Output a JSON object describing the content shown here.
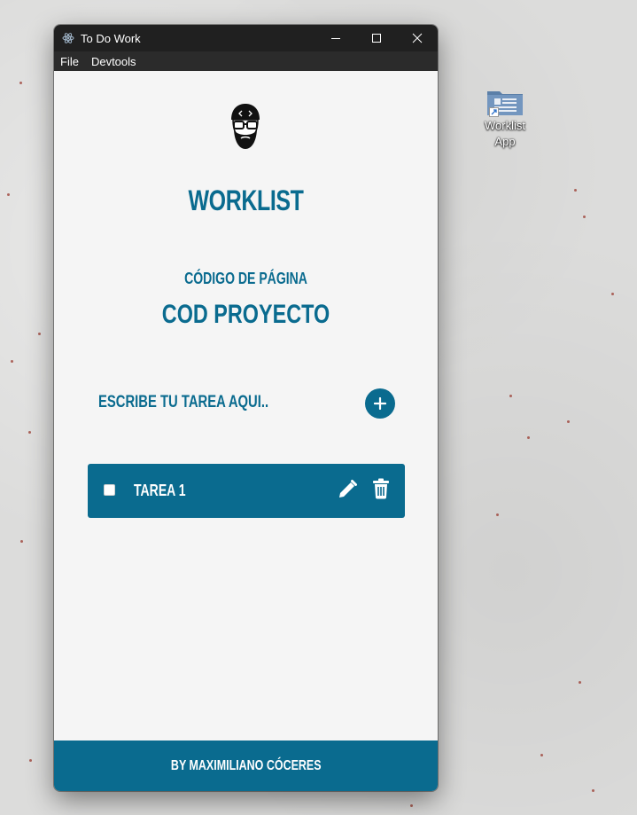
{
  "window": {
    "title": "To Do Work",
    "menu": [
      "File",
      "Devtools"
    ]
  },
  "app": {
    "title": "WORKLIST",
    "page_code_label": "CÓDIGO DE PÁGINA",
    "project_code": "COD PROYECTO",
    "task_input": {
      "placeholder": "ESCRIBE TU TAREA AQUI..",
      "value": ""
    },
    "add_button_label": "+",
    "tasks": [
      {
        "text": "TAREA 1",
        "done": false
      }
    ],
    "footer": "BY MAXIMILIANO CÓCERES"
  },
  "desktop": {
    "shortcut_label_line1": "Worklist",
    "shortcut_label_line2": "App"
  },
  "colors": {
    "accent": "#0a6b8f",
    "titlebar": "#202020",
    "menubar": "#2b2b2b",
    "window_bg": "#f5f5f5"
  },
  "icons": [
    "electron-app-icon",
    "minimize-icon",
    "maximize-icon",
    "close-icon",
    "developer-avatar-icon",
    "plus-icon",
    "pencil-icon",
    "trash-icon",
    "folder-shortcut-icon",
    "shortcut-arrow-icon"
  ]
}
